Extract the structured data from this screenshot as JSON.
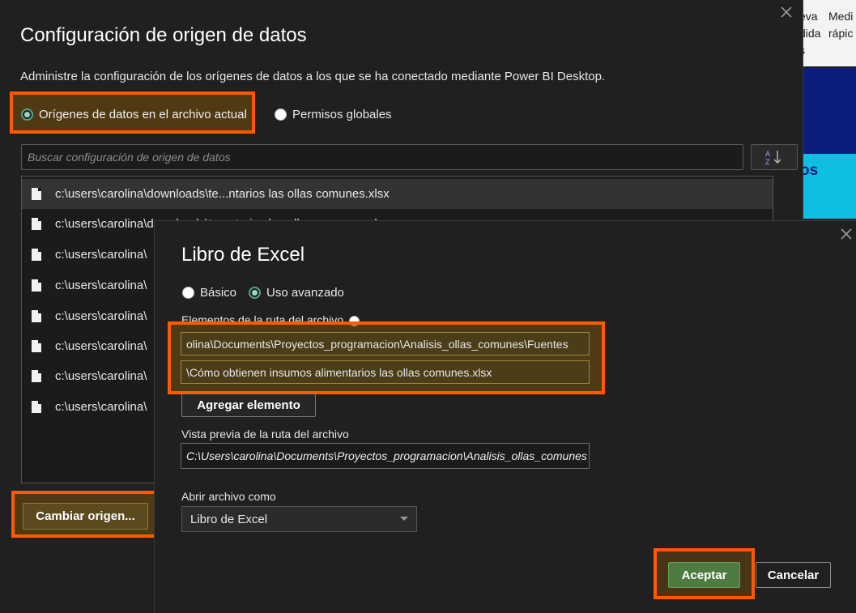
{
  "background": {
    "ribbon": {
      "btn1_line1": "eva",
      "btn1_line2": "dida",
      "btn2_line1": "Medi",
      "btn2_line2": "rápic",
      "btn3_line": "s"
    },
    "canvas_text": "os"
  },
  "main_dialog": {
    "title": "Configuración de origen de datos",
    "description": "Administre la configuración de los orígenes de datos a los que se ha conectado mediante Power BI Desktop.",
    "scope_options": [
      {
        "label": "Orígenes de datos en el archivo actual",
        "selected": true
      },
      {
        "label": "Permisos globales",
        "selected": false
      }
    ],
    "search": {
      "placeholder": "Buscar configuración de origen de datos",
      "value": ""
    },
    "sort_icon": "sort-az-icon",
    "sources": [
      "c:\\users\\carolina\\downloads\\te...ntarios las ollas comunes.xlsx",
      "c:\\users\\carolina\\downloads\\te...ntarios las ollas comunes.xlsx",
      "c:\\users\\carolina\\",
      "c:\\users\\carolina\\",
      "c:\\users\\carolina\\",
      "c:\\users\\carolina\\",
      "c:\\users\\carolina\\",
      "c:\\users\\carolina\\"
    ],
    "change_source_label": "Cambiar origen...",
    "close_icon": "close-icon"
  },
  "excel_dialog": {
    "title": "Libro de Excel",
    "mode_options": [
      {
        "label": "Básico",
        "selected": false
      },
      {
        "label": "Uso avanzado",
        "selected": true
      }
    ],
    "path_parts_label": "Elementos de la ruta del archivo",
    "path_parts": [
      "olina\\Documents\\Proyectos_programacion\\Analisis_ollas_comunes\\Fuentes",
      "\\Cómo obtienen insumos alimentarios las ollas comunes.xlsx"
    ],
    "add_element_label": "Agregar elemento",
    "preview_label": "Vista previa de la ruta del archivo",
    "preview_value": "C:\\Users\\carolina\\Documents\\Proyectos_programacion\\Analisis_ollas_comunes",
    "open_as_label": "Abrir archivo como",
    "open_as_value": "Libro de Excel",
    "ok_label": "Aceptar",
    "cancel_label": "Cancelar",
    "close_icon": "close-icon"
  },
  "colors": {
    "highlight": "#ff5a00",
    "accept_green": "#4e7b3f",
    "dialog_bg": "#202020"
  }
}
